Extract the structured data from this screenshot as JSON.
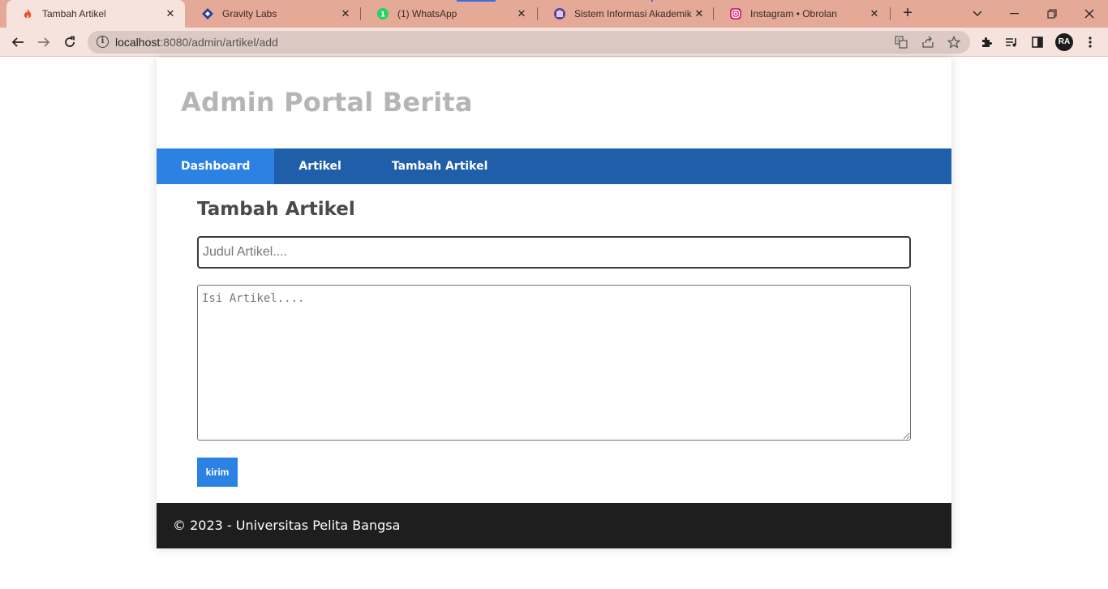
{
  "browser": {
    "tabs": [
      {
        "title": "Tambah Artikel",
        "icon": "codeigniter-flame-icon",
        "active": true
      },
      {
        "title": "Gravity Labs",
        "icon": "gravity-diamond-icon",
        "active": false
      },
      {
        "title": "(1) WhatsApp",
        "icon": "whatsapp-icon",
        "active": false
      },
      {
        "title": "Sistem Informasi Akademik",
        "icon": "university-logo-icon",
        "active": false
      },
      {
        "title": "Instagram • Obrolan",
        "icon": "instagram-icon",
        "active": false
      }
    ],
    "url_host": "localhost",
    "url_rest": ":8080/admin/artikel/add",
    "profile_initials": "RA",
    "colors": {
      "tabbar": "#e4a997",
      "toolbar": "#f6e3dd"
    }
  },
  "page": {
    "site_title": "Admin Portal Berita",
    "nav": [
      {
        "label": "Dashboard",
        "active": true
      },
      {
        "label": "Artikel",
        "active": false
      },
      {
        "label": "Tambah Artikel",
        "active": false
      }
    ],
    "form": {
      "heading": "Tambah Artikel",
      "title_placeholder": "Judul Artikel....",
      "title_value": "",
      "body_placeholder": "Isi Artikel....",
      "body_value": "",
      "submit_label": "kirim"
    },
    "footer": "© 2023 - Universitas Pelita Bangsa",
    "colors": {
      "nav": "#1f5fa9",
      "nav_active": "#2b82e3",
      "footer": "#1e1e1e"
    }
  }
}
